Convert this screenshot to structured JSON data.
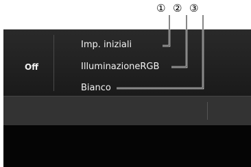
{
  "callouts": [
    "①",
    "②",
    "③"
  ],
  "side": {
    "value": "Off"
  },
  "menu": {
    "items": [
      {
        "label": "Imp. iniziali"
      },
      {
        "label": "IlluminazioneRGB"
      },
      {
        "label": "Bianco"
      }
    ]
  }
}
